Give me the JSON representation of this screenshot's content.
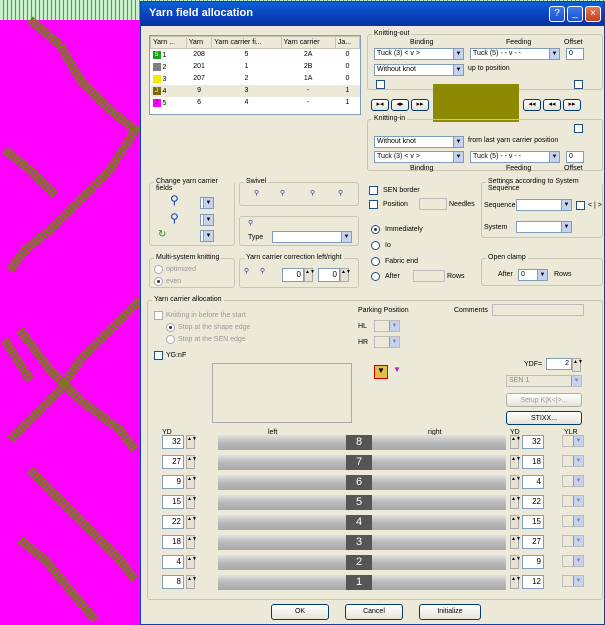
{
  "window": {
    "title": "Yarn field allocation"
  },
  "table": {
    "headers": [
      "Yarn ...",
      "Yarn",
      "Yarn carrier fi...",
      "Yarn carrier",
      "Ja..."
    ],
    "rows": [
      {
        "mark": "S",
        "idx": "1",
        "color": "#1aa01a",
        "yarn": "208",
        "field": "5",
        "carrier": "2A",
        "ja": "0"
      },
      {
        "mark": "",
        "idx": "2",
        "color": "#808080",
        "yarn": "201",
        "field": "1",
        "carrier": "2B",
        "ja": "0"
      },
      {
        "mark": "",
        "idx": "3",
        "color": "#f2e800",
        "yarn": "207",
        "field": "2",
        "carrier": "1A",
        "ja": "0"
      },
      {
        "mark": "J",
        "idx": "4",
        "color": "#7b6a10",
        "yarn": "9",
        "field": "3",
        "carrier": "-",
        "ja": "1"
      },
      {
        "mark": "J",
        "idx": "5",
        "color": "#ff00ff",
        "yarn": "6",
        "field": "4",
        "carrier": "-",
        "ja": "1"
      }
    ]
  },
  "knitting_out": {
    "title": "Knitting-out",
    "binding": "Binding",
    "feeding": "Feeding",
    "offset": "Offset",
    "binding_value": "Tuck (3) < v >",
    "feeding_value": "Tuck (5) - - v - -",
    "knot_value": "Without knot",
    "up_to": "up to position",
    "offset_value": "0"
  },
  "knitting_in": {
    "title": "Knitting-in",
    "knot_value": "Without knot",
    "from_last": "from last yarn carrier position",
    "binding_value": "Tuck (3) < v >",
    "feeding_value": "Tuck (5) - - v - -",
    "binding": "Binding",
    "feeding": "Feeding",
    "offset": "Offset",
    "offset_value": "0"
  },
  "nav": {
    "b1": "▸◂",
    "b2": "◂▸",
    "b3": "▸▸",
    "b4": "◂◂",
    "b5": "◂◂",
    "b6": "▸▸"
  },
  "carrier_fields": {
    "title": "Change yarn carrier fields"
  },
  "swivel": {
    "title": "Swivel",
    "type": "Type"
  },
  "sen": {
    "border": "SEN border",
    "position": "Position",
    "needles": "Needles",
    "immediately": "Immediately",
    "io": "Io",
    "fabric_end": "Fabric end",
    "after": "After",
    "rows": "Rows"
  },
  "settings": {
    "title": "Settings according to System Sequence",
    "sequence": "Sequence",
    "system": "System",
    "cs": "< | >"
  },
  "multi": {
    "title": "Multi-system knitting",
    "optimized": "optimized",
    "even": "even"
  },
  "correction": {
    "title": "Yarn carrier correction left/right",
    "v1": "0",
    "v2": "0"
  },
  "open_clamp": {
    "title": "Open clamp",
    "after": "After",
    "value": "0",
    "rows": "Rows"
  },
  "alloc": {
    "title": "Yarn carrier allocation",
    "knit_before": "Knitting in before the start",
    "stop_shape": "Stop at the shape edge",
    "stop_sen": "Stop at the SEN edge",
    "parking": "Parking Position",
    "hl": "HL",
    "hr": "HR",
    "comments": "Comments",
    "ygnf": "YG:nF",
    "ydf": "YDF=",
    "ydf_value": "2",
    "sen1": "SEN 1",
    "setup": "Setup K|K<|>...",
    "stixx": "STIXX..."
  },
  "yd": {
    "left": "YD",
    "left_lbl": "left",
    "right_lbl": "right",
    "right": "YD",
    "ylr": "YLR",
    "rows": [
      {
        "n": "8",
        "l": "32",
        "r": "32"
      },
      {
        "n": "7",
        "l": "27",
        "r": "18"
      },
      {
        "n": "6",
        "l": "9",
        "r": "4"
      },
      {
        "n": "5",
        "l": "15",
        "r": "22"
      },
      {
        "n": "4",
        "l": "22",
        "r": "15"
      },
      {
        "n": "3",
        "l": "18",
        "r": "27"
      },
      {
        "n": "2",
        "l": "4",
        "r": "9"
      },
      {
        "n": "1",
        "l": "8",
        "r": "12"
      }
    ]
  },
  "buttons": {
    "ok": "OK",
    "cancel": "Cancel",
    "init": "Initialize"
  },
  "colors": {
    "swatch": "#8b8a00",
    "magenta": "#ff00ff",
    "accent": "#0a3fb8"
  }
}
